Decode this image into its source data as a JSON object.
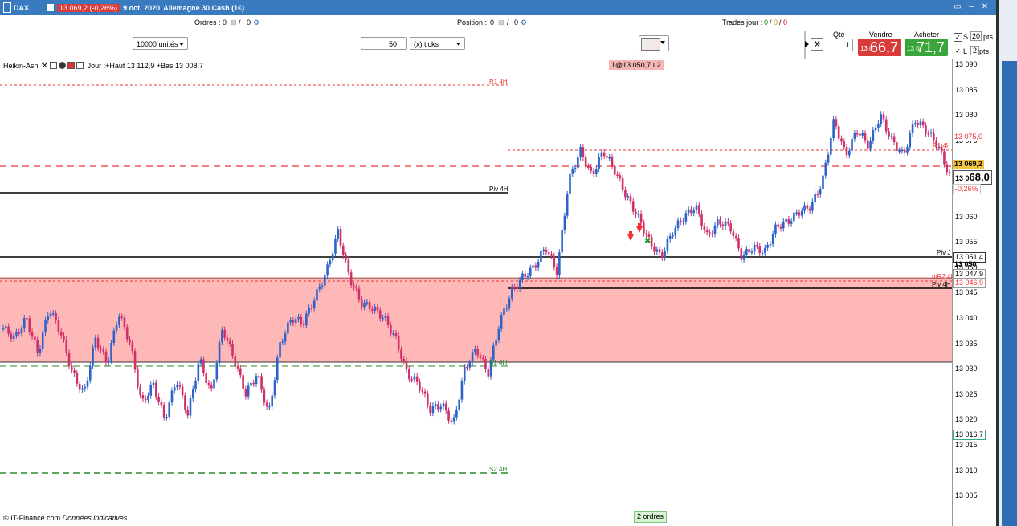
{
  "titlebar": {
    "instrument": "DAX",
    "quote": "13 069,2 (-0,26%)",
    "date": "9 oct. 2020",
    "name": "Allemagne 30 Cash (1€)"
  },
  "toolbar": {
    "orders_label": "Ordres :",
    "orders_value": "0",
    "position_label": "Position :",
    "position_value": "0",
    "trades_label": "Trades jour :",
    "trades_green": "0",
    "trades_orange": "0",
    "trades_red": "0"
  },
  "controls": {
    "units": "10000 unités",
    "ticks_value": "50",
    "ticks_unit": "(x) ticks"
  },
  "order_panel": {
    "qty_label": "Qté",
    "qty_value": "1",
    "sell_label": "Vendre",
    "buy_label": "Acheter",
    "sell_small": "13 0",
    "sell_big": "66,7",
    "buy_small": "13 0",
    "buy_big": "71,7",
    "s_label": "S",
    "s_value": "20",
    "s_unit": "pts",
    "l_label": "L",
    "l_value": "2",
    "l_unit": "pts"
  },
  "chart": {
    "info": "Heikin-Ashi",
    "period": "Jour :+Haut 13 112,9 +Bas 13 008,7",
    "order_tag": "1@13 050,7 ı,2",
    "orders_badge": "2 ordres",
    "footer": "© IT-Finance.com",
    "footer2": "Données indicatives",
    "levels": {
      "r1": "R1 4H",
      "piv4h": "Piv 4H",
      "s1": "S1 4H",
      "s2": "S2 4H",
      "pivj": "Piv J",
      "mr2": "mR2 4H",
      "r1b": "R1 4H",
      "piv4hb": "Piv 4H"
    },
    "axis_ticks": [
      "13 090",
      "13 085",
      "13 080",
      "13 075",
      "13 070",
      "13 065",
      "13 060",
      "13 055",
      "13 050",
      "13 045",
      "13 040",
      "13 035",
      "13 030",
      "13 025",
      "13 020",
      "13 015",
      "13 010",
      "13 005"
    ],
    "price_tags": {
      "r1_value": "13 075,0",
      "last": "13 069,2",
      "current_small": "13 0",
      "current_big": "68,0",
      "change": "-0,26%",
      "pivj": "13 051,4",
      "p13050": "13 050",
      "mr2": "13 047,9",
      "piv4h": "13 046,9",
      "low": "13 016,7"
    },
    "colors": {
      "up": "#2d63c9",
      "down": "#d0306a",
      "zone": "#ffb8b8",
      "r1": "#e33",
      "support": "#2a8a2a"
    }
  },
  "chart_data": {
    "type": "line",
    "title": "DAX Heikin-Ashi",
    "ylim": [
      13000,
      13092
    ],
    "close_points": [
      13038,
      13036,
      13040,
      13033,
      13042,
      13037,
      13029,
      13025,
      13036,
      13031,
      13041,
      13035,
      13023,
      13027,
      13020,
      13028,
      13021,
      13032,
      13025,
      13038,
      13032,
      13025,
      13029,
      13021,
      13035,
      13040,
      13039,
      13044,
      13049,
      13057,
      13048,
      13043,
      13042,
      13040,
      13036,
      13029,
      13027,
      13022,
      13023,
      13019,
      13030,
      13034,
      13029,
      13039,
      13045,
      13048,
      13050,
      13054,
      13049,
      13067,
      13073,
      13068,
      13073,
      13069,
      13064,
      13060,
      13055,
      13052,
      13057,
      13060,
      13062,
      13056,
      13059,
      13058,
      13052,
      13054,
      13053,
      13058,
      13059,
      13061,
      13062,
      13067,
      13079,
      13072,
      13077,
      13074,
      13080,
      13075,
      13072,
      13079,
      13077,
      13074,
      13068
    ]
  }
}
